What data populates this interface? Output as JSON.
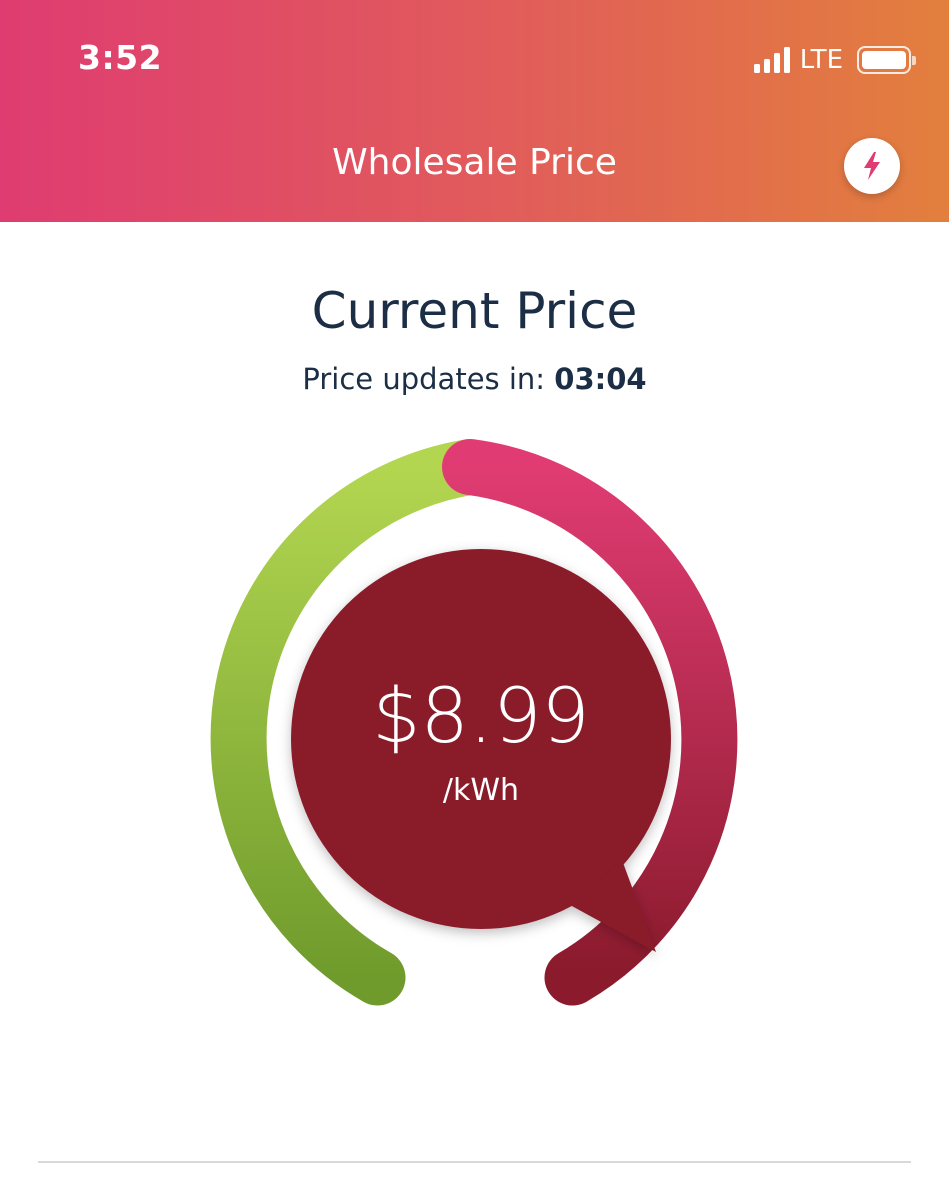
{
  "status_bar": {
    "time": "3:52",
    "network": "LTE",
    "signal_bars": 4,
    "battery_level": 1.0
  },
  "header": {
    "title": "Wholesale Price",
    "action_icon": "lightning-bolt-icon",
    "gradient_colors": [
      "#df3c71",
      "#e27f3d"
    ]
  },
  "main": {
    "title": "Current Price",
    "update_label": "Price updates in:",
    "update_countdown": "03:04"
  },
  "gauge": {
    "price": "$8.99",
    "unit": "/kWh",
    "colors": {
      "low": "#b0d34c",
      "low_dark": "#6e9a2b",
      "high": "#e03c73",
      "high_dark": "#8a1a2c",
      "bubble": "#8a1a2c"
    },
    "pointer_fraction": 0.87
  }
}
